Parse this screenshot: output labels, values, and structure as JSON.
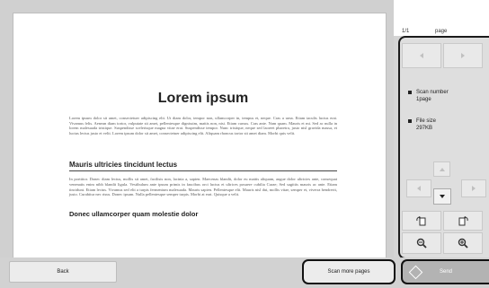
{
  "preview": {
    "title": "Lorem ipsum",
    "paragraph1": "Lorem ipsum dolor sit amet, consectetuer adipiscing elit. Ut diam dolor, tempor non, ullamcorper in, tempus et, neque. Cras a urna. Etiam iaculis luctus erat. Vivamus felis. Aenean diam tortor, vulputate sit amet, pellentesque dignissim, mattis non, nisi. Etiam cursus. Cras ante. Nam quam. Mauris et mi. Sed ac nulla in lorem malesuada tristique. Suspendisse scelerisque magna vitae erat. Suspendisse tempor. Nunc tristique, neque sed laoreet pharetra, justo nisl gravida massa, et luctus lectus justo et velit. Lorem ipsum dolor sit amet, consectetuer adipiscing elit. Aliquam rhoncus tortor sit amet diam. Morbi quis velit.",
    "section1_title": "Mauris ultricies tincidunt lectus",
    "paragraph2": "In porttitor. Donec diam lectus, mollis sit amet, facilisis non, lacinia a, sapien. Maecenas blandit, dolor eu mattis aliquam, augue dolor ultricies ante, consequat venenatis enim nibh blandit ligula. Vestibulum ante ipsum primis in faucibus orci luctus et ultrices posuere cubilia Curae; Sed sagittis mauris ac ante. Etiam tincidunt. Etiam lectus. Vivamus sed elit a turpis fermentum malesuada. Mauris sapien. Pellentesque elit. Mauris nisl dui, mollis vitae, semper et, viverra hendrerit, justo. Curabitur nec risus. Donec ipsum. Nulla pellentesque semper turpis. Morbi at erat. Quisque a velit.",
    "section2_title": "Donec ullamcorper quam molestie dolor"
  },
  "pager": {
    "indicator": "1/1",
    "unit": "page"
  },
  "info": {
    "scan_number_label": "Scan number",
    "scan_number_value": "1page",
    "file_size_label": "File size",
    "file_size_value": "297KB"
  },
  "icons": {
    "prev_page": "chevron-left-icon",
    "next_page": "chevron-right-icon",
    "rotate_left": "rotate-left-icon",
    "rotate_right": "rotate-right-icon",
    "zoom_out": "zoom-out-icon",
    "zoom_in": "zoom-in-icon",
    "send": "send-icon"
  },
  "buttons": {
    "back": "Back",
    "scan_more": "Scan more pages",
    "send": "Send"
  },
  "colors": {
    "send_disabled": "#b3b3b3",
    "panel_border": "#1a1a1a"
  }
}
